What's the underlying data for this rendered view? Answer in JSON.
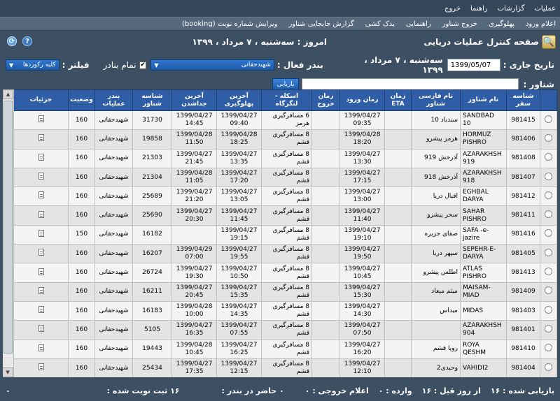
{
  "menu": {
    "items": [
      "عملیات",
      "گزارشات",
      "راهنما",
      "خروج"
    ]
  },
  "submenu": {
    "items": [
      "اعلام ورود",
      "پهلوگیری",
      "خروج شناور",
      "راهنمایی",
      "یدک کشی",
      "گزارش جابجایی شناور",
      "ویرایش شماره نوبت (booking)"
    ]
  },
  "header": {
    "title": "صفحه کنترل عملیات دریایی",
    "today": "امروز : سه‌شنبه ، ۷ مرداد ، ۱۳۹۹"
  },
  "filters": {
    "date_label": "تاریخ جاری :",
    "date_value": "1399/05/07",
    "date_long": "سه‌شنبه ، ۷ مرداد ، ۱۳۹۹",
    "port_label": "بندر فعال :",
    "port_value": "شهیدحقانی",
    "all_ports_label": "تمام بنادر",
    "filter_label": "فیلتر :",
    "filter_value": "کلیه رکوردها",
    "vessel_label": "شناور :",
    "retrieve_button": "بازیابی"
  },
  "table": {
    "columns": [
      "",
      "شناسه سفر",
      "نام شناور",
      "نام فارسی شناور",
      "زمان ETA",
      "زمان ورود",
      "زمان خروج",
      "اسکله - لنگرگاه",
      "آخرین پهلوگیری",
      "آخرین جداشدن",
      "شناسه شناور",
      "بندر عملیات",
      "وضعیت",
      "جزئیات"
    ],
    "rows": [
      [
        "981415",
        "SANDBAD 10",
        "سندباد 10",
        "",
        "1399/04/27 09:35",
        "",
        "6 مسافرگیری هرمز",
        "1399/04/27 09:40",
        "1399/04/27 14:45",
        "31730",
        "شهیدحقانی",
        "160"
      ],
      [
        "981406",
        "HORMUZ PISHRO",
        "هرمز پیشرو",
        "",
        "1399/04/28 18:20",
        "",
        "8 مسافرگیری قشم",
        "1399/04/28 18:25",
        "1399/04/28 11:50",
        "19858",
        "شهیدحقانی",
        "160"
      ],
      [
        "981408",
        "AZARAKHSH 919",
        "آذرخش 919",
        "",
        "1399/04/27 13:30",
        "",
        "8 مسافرگیری قشم",
        "1399/04/27 13:35",
        "1399/04/27 21:45",
        "21303",
        "شهیدحقانی",
        "160"
      ],
      [
        "981407",
        "AZARAKHSH 918",
        "آذرخش 918",
        "",
        "1399/04/27 17:15",
        "",
        "8 مسافرگیری قشم",
        "1399/04/27 17:20",
        "1399/04/28 11:05",
        "21304",
        "شهیدحقانی",
        "160"
      ],
      [
        "981412",
        "EGHBAL DARYA",
        "اقبال دریا",
        "",
        "1399/04/27 13:00",
        "",
        "8 مسافرگیری قشم",
        "1399/04/27 13:05",
        "1399/04/27 21:20",
        "25689",
        "شهیدحقانی",
        "160"
      ],
      [
        "981411",
        "SAHAR PISHRO",
        "سحر پیشرو",
        "",
        "1399/04/27 11:40",
        "",
        "8 مسافرگیری قشم",
        "1399/04/27 11:45",
        "1399/04/27 20:30",
        "25690",
        "شهیدحقانی",
        "160"
      ],
      [
        "981416",
        "SAFA -e-jazire",
        "صفای جزیره",
        "",
        "1399/04/27 19:10",
        "",
        "8 مسافرگیری قشم",
        "1399/04/27 19:15",
        "",
        "16182",
        "شهیدحقانی",
        "150"
      ],
      [
        "981405",
        "SEPEHR-E-DARYA",
        "سپهر دریا",
        "",
        "1399/04/27 19:50",
        "",
        "8 مسافرگیری قشم",
        "1399/04/27 19:55",
        "1399/04/29 07:00",
        "16207",
        "شهیدحقانی",
        "160"
      ],
      [
        "981413",
        "ATLAS PISHRO",
        "اطلس پیشرو",
        "",
        "1399/04/27 10:45",
        "",
        "8 مسافرگیری قشم",
        "1399/04/27 10:50",
        "1399/04/27 19:30",
        "26724",
        "شهیدحقانی",
        "160"
      ],
      [
        "981409",
        "MAISAM-MIAD",
        "میثم میعاد",
        "",
        "1399/04/27 15:30",
        "",
        "8 مسافرگیری قشم",
        "1399/04/27 15:35",
        "1399/04/27 20:45",
        "16211",
        "شهیدحقانی",
        "160"
      ],
      [
        "981403",
        "MIDAS",
        "میداس",
        "",
        "1399/04/27 14:30",
        "",
        "8 مسافرگیری قشم",
        "1399/04/27 14:35",
        "1399/04/28 10:00",
        "16183",
        "شهیدحقانی",
        "160"
      ],
      [
        "981401",
        "AZARAKHSH 904",
        "",
        "",
        "1399/04/27 07:50",
        "",
        "8 مسافرگیری قشم",
        "1399/04/27 07:55",
        "1399/04/27 16:35",
        "5105",
        "شهیدحقانی",
        "160"
      ],
      [
        "981410",
        "ROYA QESHM",
        "رویا قشم",
        "",
        "1399/04/27 16:20",
        "",
        "8 مسافرگیری قشم",
        "1399/04/27 16:25",
        "1399/04/28 10:45",
        "19443",
        "شهیدحقانی",
        "160"
      ],
      [
        "981404",
        "VAHIDI2",
        "وحیدی2",
        "",
        "1399/04/27 12:10",
        "",
        "8 مسافرگیری قشم",
        "1399/04/27 12:15",
        "1399/04/27 17:35",
        "25434",
        "شهیدحقانی",
        "160"
      ]
    ]
  },
  "status": {
    "retrieved": "بازیابی شده : ۱۶",
    "from_before": "از روز قبل : ۱۶",
    "arrived": "وارده : ۰",
    "exit_declared": "اعلام خروجی : ۰",
    "in_port": "۰ حاضر در بندر :",
    "booked": "۱۶ ثبت نوبت شده :",
    "last": "۰"
  }
}
